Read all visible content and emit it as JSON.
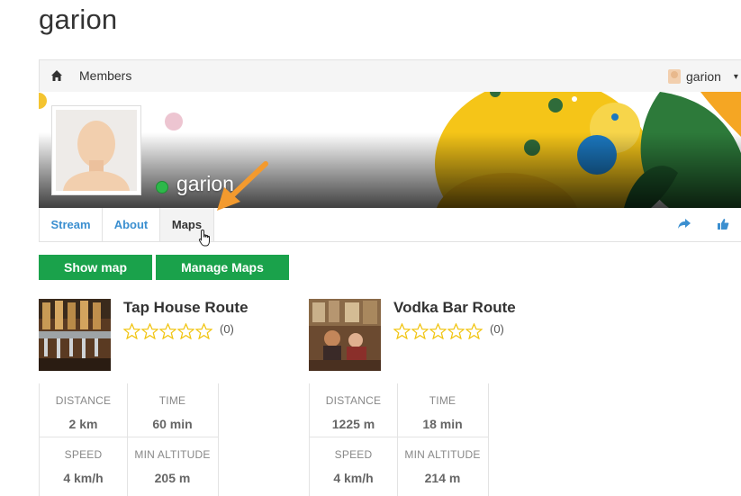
{
  "page": {
    "title": "garion"
  },
  "navbar": {
    "members_label": "Members",
    "user_name": "garion"
  },
  "profile": {
    "name": "garion",
    "status": "online"
  },
  "tabs": [
    {
      "label": "Stream",
      "active": false
    },
    {
      "label": "About",
      "active": false
    },
    {
      "label": "Maps",
      "active": true
    }
  ],
  "actions": {
    "show_map": "Show map",
    "manage_maps": "Manage Maps"
  },
  "maps": [
    {
      "title": "Tap House Route",
      "rating_count": "(0)",
      "stats": [
        {
          "label": "DISTANCE",
          "value": "2 km"
        },
        {
          "label": "TIME",
          "value": "60 min"
        },
        {
          "label": "SPEED",
          "value": "4 km/h"
        },
        {
          "label": "MIN ALTITUDE",
          "value": "205 m"
        }
      ]
    },
    {
      "title": "Vodka Bar Route",
      "rating_count": "(0)",
      "stats": [
        {
          "label": "DISTANCE",
          "value": "1225 m"
        },
        {
          "label": "TIME",
          "value": "18 min"
        },
        {
          "label": "SPEED",
          "value": "4 km/h"
        },
        {
          "label": "MIN ALTITUDE",
          "value": "214 m"
        }
      ]
    }
  ],
  "colors": {
    "accent_green": "#1aa24b",
    "link_blue": "#3b8fd0",
    "online_green": "#2db84a",
    "annotation_orange": "#f39a2e",
    "star_yellow": "#f1c40f"
  },
  "icons": {
    "home": "home-icon",
    "share": "share-icon",
    "like": "thumbs-up-icon",
    "cursor": "hand-pointer-icon",
    "annotation": "arrow-annotation-icon"
  }
}
